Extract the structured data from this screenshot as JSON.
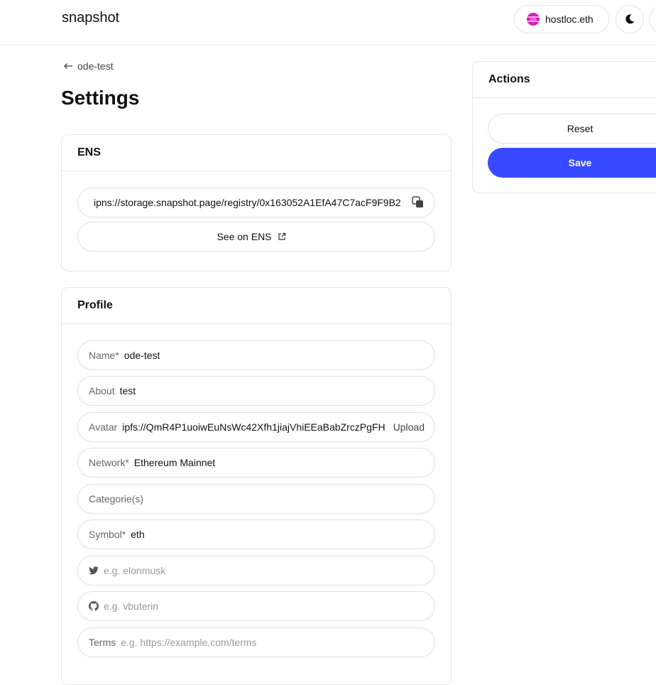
{
  "header": {
    "logo": "snapshot",
    "account_name": "hostloc.eth",
    "theme_icon": "moon-icon"
  },
  "nav": {
    "back_label": "ode-test"
  },
  "page": {
    "title": "Settings"
  },
  "ens": {
    "heading": "ENS",
    "url": "ipns://storage.snapshot.page/registry/0x163052A1EfA47C7acF9F9B2",
    "see_on_ens": "See on ENS"
  },
  "profile": {
    "heading": "Profile",
    "name": {
      "label": "Name*",
      "value": "ode-test"
    },
    "about": {
      "label": "About",
      "value": "test"
    },
    "avatar": {
      "label": "Avatar",
      "value": "ipfs://QmR4P1uoiwEuNsWc42Xfh1jiajVhiEEaBabZrczPgFH",
      "action": "Upload"
    },
    "network": {
      "label": "Network*",
      "value": "Ethereum Mainnet"
    },
    "categories": {
      "label": "Categorie(s)"
    },
    "symbol": {
      "label": "Symbol*",
      "value": "eth"
    },
    "twitter": {
      "placeholder": "e.g. elonmusk"
    },
    "github": {
      "placeholder": "e.g. vbuterin"
    },
    "terms": {
      "label": "Terms",
      "placeholder": "e.g. https://example.com/terms"
    }
  },
  "actions": {
    "heading": "Actions",
    "reset": "Reset",
    "save": "Save"
  },
  "colors": {
    "accent": "#384aff",
    "border": "#e5e5e5"
  }
}
